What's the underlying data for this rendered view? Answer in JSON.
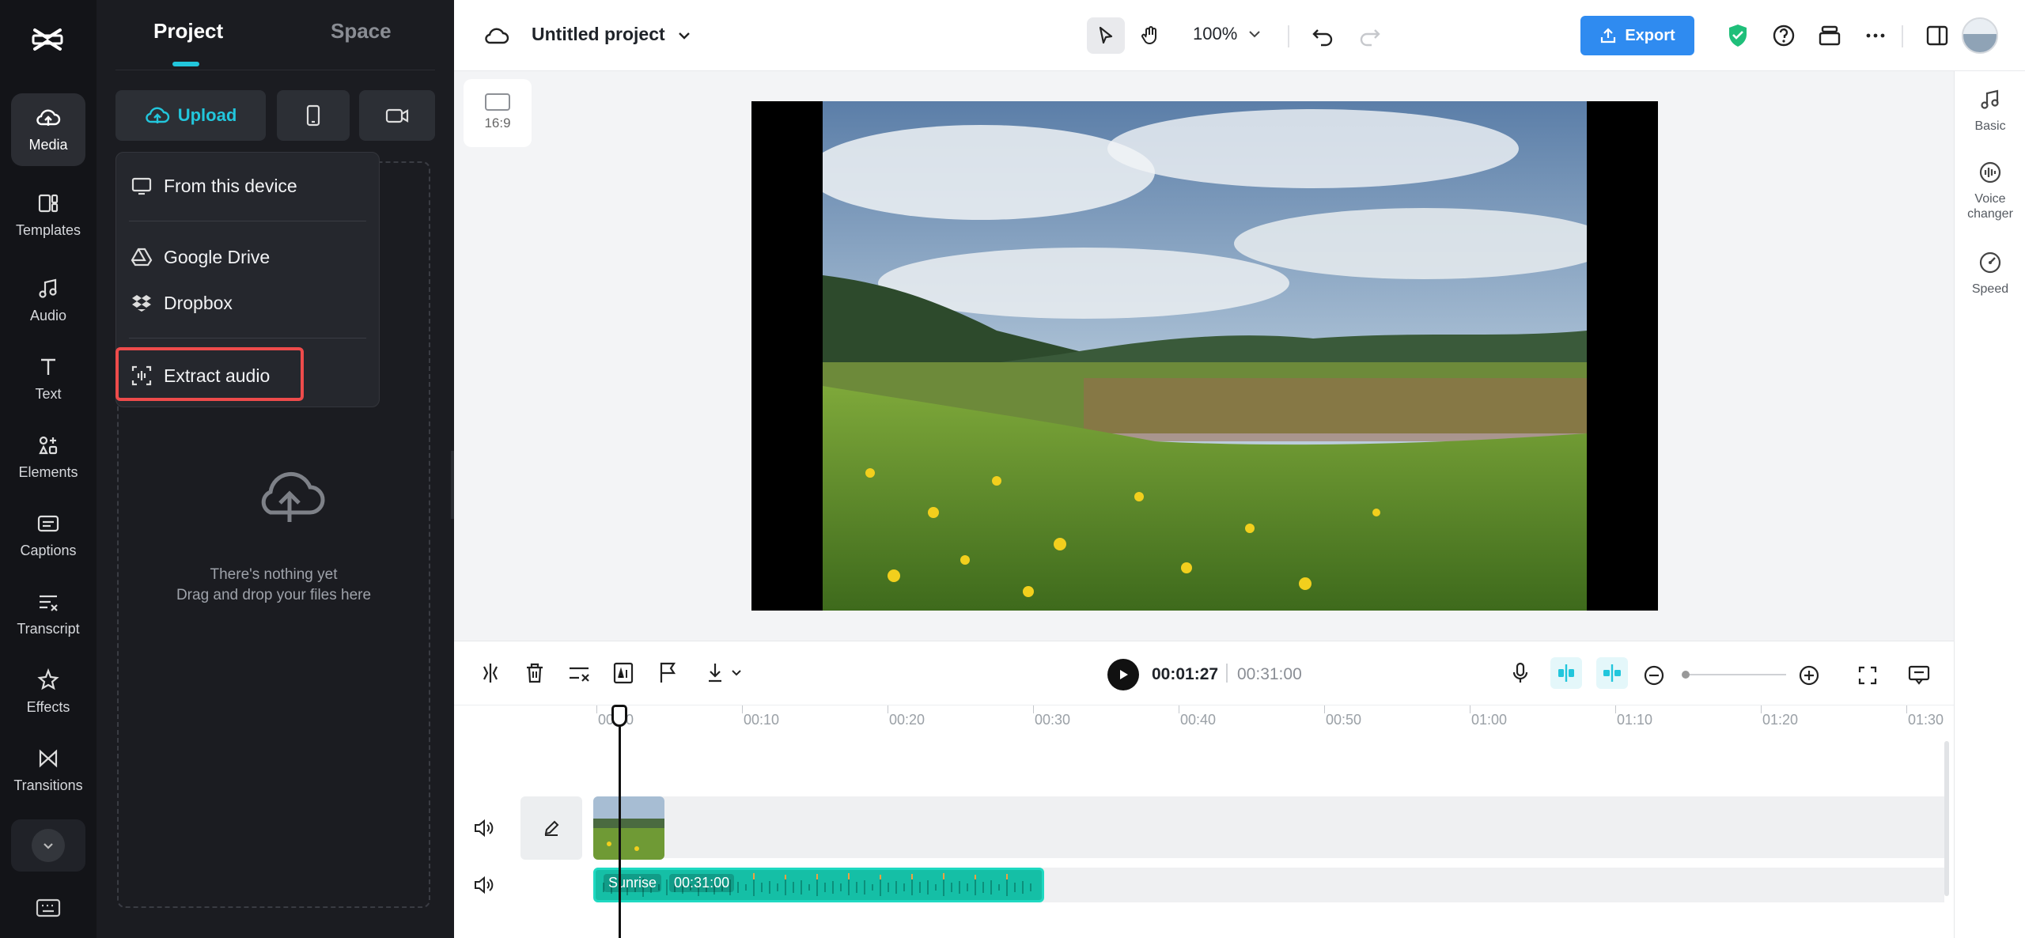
{
  "rail": {
    "items": [
      {
        "label": "Media",
        "icon": "media-cloud-icon"
      },
      {
        "label": "Templates",
        "icon": "templates-icon"
      },
      {
        "label": "Audio",
        "icon": "audio-note-icon"
      },
      {
        "label": "Text",
        "icon": "text-icon"
      },
      {
        "label": "Elements",
        "icon": "elements-icon"
      },
      {
        "label": "Captions",
        "icon": "captions-icon"
      },
      {
        "label": "Transcript",
        "icon": "transcript-icon"
      },
      {
        "label": "Effects",
        "icon": "effects-icon"
      },
      {
        "label": "Transitions",
        "icon": "transitions-icon"
      }
    ]
  },
  "panel": {
    "tabs": [
      {
        "label": "Project"
      },
      {
        "label": "Space"
      }
    ],
    "upload_label": "Upload",
    "empty_line1": "There's nothing yet",
    "empty_line2": "Drag and drop your files here"
  },
  "dropdown": {
    "items": [
      {
        "label": "From this device"
      },
      {
        "label": "Google Drive"
      },
      {
        "label": "Dropbox"
      },
      {
        "label": "Extract audio"
      }
    ]
  },
  "topbar": {
    "title": "Untitled project",
    "zoom": "100%",
    "export_label": "Export"
  },
  "canvas": {
    "ratio": "16:9"
  },
  "right_panel": {
    "items": [
      {
        "label": "Basic"
      },
      {
        "label": "Voice changer"
      },
      {
        "label": "Speed"
      }
    ]
  },
  "timeline": {
    "current_time": "00:01:27",
    "total_time": "00:31:00",
    "ticks": [
      "00:00",
      "00:10",
      "00:20",
      "00:30",
      "00:40",
      "00:50",
      "01:00",
      "01:10",
      "01:20",
      "01:30"
    ],
    "audio_clip_name": "Sunrise",
    "audio_clip_duration": "00:31:00"
  },
  "colors": {
    "accent": "#22c6dc",
    "export": "#2f8bf0",
    "highlight": "#ee4b4b",
    "audio_clip": "#15bfa6"
  }
}
